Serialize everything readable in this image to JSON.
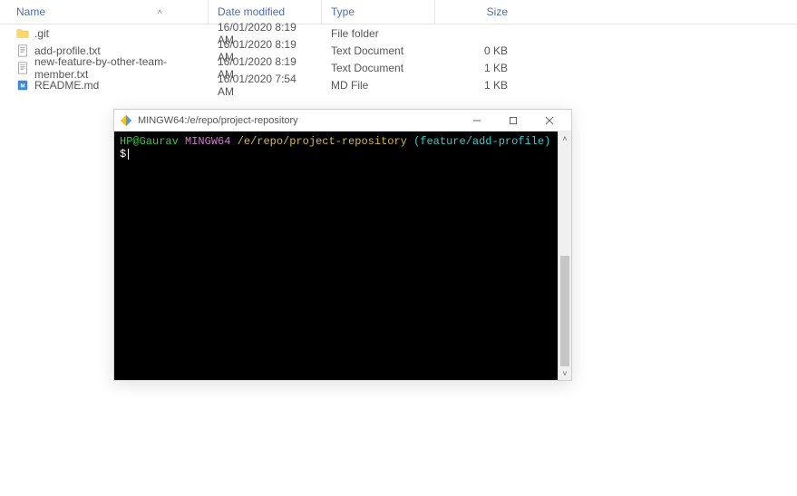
{
  "explorer": {
    "columns": {
      "name": "Name",
      "date": "Date modified",
      "type": "Type",
      "size": "Size"
    },
    "rows": [
      {
        "icon": "folder",
        "name": ".git",
        "date": "16/01/2020 8:19 AM",
        "type": "File folder",
        "size": ""
      },
      {
        "icon": "text",
        "name": "add-profile.txt",
        "date": "16/01/2020 8:19 AM",
        "type": "Text Document",
        "size": "0 KB"
      },
      {
        "icon": "text",
        "name": "new-feature-by-other-team-member.txt",
        "date": "16/01/2020 8:19 AM",
        "type": "Text Document",
        "size": "1 KB"
      },
      {
        "icon": "md",
        "name": "README.md",
        "date": "16/01/2020 7:54 AM",
        "type": "MD File",
        "size": "1 KB"
      }
    ]
  },
  "terminal": {
    "title": "MINGW64:/e/repo/project-repository",
    "prompt": {
      "user": "HP@Gaurav",
      "host": "MINGW64",
      "path": "/e/repo/project-repository",
      "branch": "(feature/add-profile)",
      "symbol": "$"
    }
  }
}
